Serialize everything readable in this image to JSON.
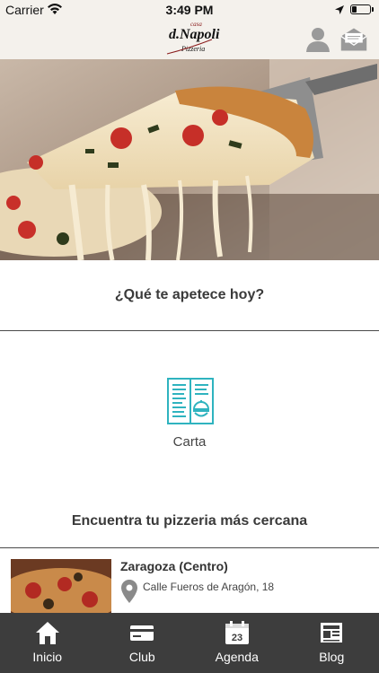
{
  "status_bar": {
    "carrier": "Carrier",
    "time": "3:49 PM",
    "battery_level": 0.25
  },
  "header": {
    "logo": {
      "small": "casa",
      "main": "d.Napoli",
      "sub": "Pizzeria"
    },
    "icons": [
      "user-icon",
      "mail-icon"
    ]
  },
  "main": {
    "question": "¿Qué te apetece hoy?",
    "menu_item": {
      "label": "Carta",
      "icon": "menu-card-icon"
    },
    "nearby_title": "Encuentra tu pizzeria más cercana",
    "store": {
      "name": "Zaragoza (Centro)",
      "address": "Calle Fueros de Aragón, 18"
    }
  },
  "tab_bar": {
    "tabs": [
      {
        "label": "Inicio",
        "icon": "home-icon"
      },
      {
        "label": "Club",
        "icon": "card-icon"
      },
      {
        "label": "Agenda",
        "icon": "calendar-icon",
        "icon_text": "23"
      },
      {
        "label": "Blog",
        "icon": "newspaper-icon"
      }
    ]
  },
  "colors": {
    "accent_teal": "#2fb3bf",
    "tab_bar_bg": "#3d3d3d",
    "header_bg": "#f4f1ec"
  }
}
